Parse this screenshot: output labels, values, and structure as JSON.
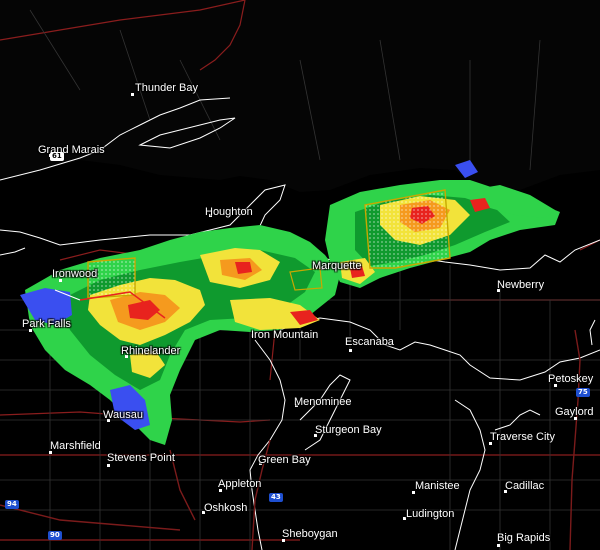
{
  "map": {
    "colors": {
      "background": "#000000",
      "land": "#050505",
      "state_border": "#8a1d1d",
      "county_border": "#3a3a3a",
      "coastline": "#ffffff",
      "interstate": "#7b1b1b",
      "warning_box": "#c8a800",
      "radar_light_green": "#2fd34a",
      "radar_dark_green": "#0f9a2e",
      "radar_yellow": "#f2e33a",
      "radar_orange": "#f59a1e",
      "radar_red": "#e8231e",
      "radar_blue": "#3a4ff0"
    },
    "cities": [
      {
        "name": "Thunder Bay"
      },
      {
        "name": "Grand Marais"
      },
      {
        "name": "Houghton"
      },
      {
        "name": "Ironwood"
      },
      {
        "name": "Marquette"
      },
      {
        "name": "Newberry"
      },
      {
        "name": "Park Falls"
      },
      {
        "name": "Rhinelander"
      },
      {
        "name": "Iron Mountain"
      },
      {
        "name": "Escanaba"
      },
      {
        "name": "Petoskey"
      },
      {
        "name": "Menominee"
      },
      {
        "name": "Gaylord"
      },
      {
        "name": "Wausau"
      },
      {
        "name": "Sturgeon Bay"
      },
      {
        "name": "Traverse City"
      },
      {
        "name": "Marshfield"
      },
      {
        "name": "Stevens Point"
      },
      {
        "name": "Green Bay"
      },
      {
        "name": "Appleton"
      },
      {
        "name": "Manistee"
      },
      {
        "name": "Cadillac"
      },
      {
        "name": "Oshkosh"
      },
      {
        "name": "Ludington"
      },
      {
        "name": "Sheboygan"
      },
      {
        "name": "Big Rapids"
      }
    ],
    "highway_shields": [
      {
        "label": "75",
        "color": "#1e4fd0"
      },
      {
        "label": "43",
        "color": "#1e4fd0"
      },
      {
        "label": "94",
        "color": "#1e4fd0"
      },
      {
        "label": "90",
        "color": "#1e4fd0"
      },
      {
        "label": "61",
        "color": "#ffffff"
      }
    ]
  }
}
